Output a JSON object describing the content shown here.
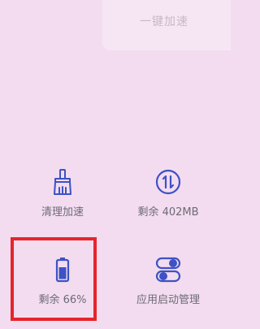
{
  "header": {
    "faded_text": "一键加速"
  },
  "tiles": [
    {
      "label": "清理加速",
      "icon": "broom-icon"
    },
    {
      "label": "剩余 402MB",
      "icon": "memory-swap-icon"
    },
    {
      "label": "剩余 66%",
      "icon": "battery-icon"
    },
    {
      "label": "应用启动管理",
      "icon": "toggle-icon"
    }
  ],
  "colors": {
    "accent": "#3d52c4",
    "background": "#f3dcf0",
    "highlight": "#e5252b"
  }
}
